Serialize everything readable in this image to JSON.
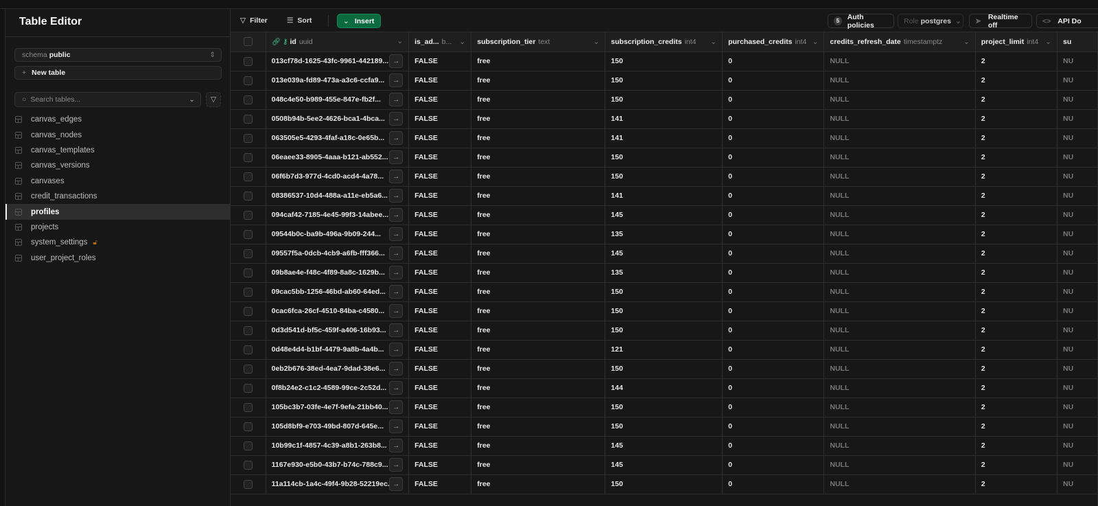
{
  "sidebar": {
    "title": "Table Editor",
    "schema_label": "schema",
    "schema_value": "public",
    "new_table": "New table",
    "search_placeholder": "Search tables...",
    "tables": [
      {
        "name": "canvas_edges"
      },
      {
        "name": "canvas_nodes"
      },
      {
        "name": "canvas_templates"
      },
      {
        "name": "canvas_versions"
      },
      {
        "name": "canvases"
      },
      {
        "name": "credit_transactions"
      },
      {
        "name": "profiles",
        "active": true
      },
      {
        "name": "projects"
      },
      {
        "name": "system_settings",
        "icon": "unlocked-icon"
      },
      {
        "name": "user_project_roles"
      }
    ]
  },
  "toolbar": {
    "filter": "Filter",
    "sort": "Sort",
    "insert": "Insert",
    "auth_count": "5",
    "auth": "Auth policies",
    "role_label": "Role",
    "role_value": "postgres",
    "realtime": "Realtime off",
    "api_docs": "API Do"
  },
  "colors": {
    "accent": "#0b6b3e",
    "background": "#171717",
    "lock": "#b26b16"
  },
  "columns": [
    {
      "name": "id",
      "type": "uuid"
    },
    {
      "name": "is_ad...",
      "type": "b..."
    },
    {
      "name": "subscription_tier",
      "type": "text"
    },
    {
      "name": "subscription_credits",
      "type": "int4"
    },
    {
      "name": "purchased_credits",
      "type": "int4"
    },
    {
      "name": "credits_refresh_date",
      "type": "timestamptz"
    },
    {
      "name": "project_limit",
      "type": "int4"
    },
    {
      "name": "su",
      "type": ""
    }
  ],
  "rows": [
    [
      "013cf78d-1625-43fc-9961-442189...",
      "150"
    ],
    [
      "013e039a-fd89-473a-a3c6-ccfa9...",
      "150"
    ],
    [
      "048c4e50-b989-455e-847e-fb2f...",
      "150"
    ],
    [
      "0508b94b-5ee2-4626-bca1-4bca...",
      "141"
    ],
    [
      "063505e5-4293-4faf-a18c-0e65b...",
      "141"
    ],
    [
      "06eaee33-8905-4aaa-b121-ab552...",
      "150"
    ],
    [
      "06f6b7d3-977d-4cd0-acd4-4a78...",
      "150"
    ],
    [
      "08386537-10d4-488a-a11e-eb5a6...",
      "141"
    ],
    [
      "094caf42-7185-4e45-99f3-14abee...",
      "145"
    ],
    [
      "09544b0c-ba9b-496a-9b09-244...",
      "135"
    ],
    [
      "09557f5a-0dcb-4cb9-a6fb-fff366...",
      "145"
    ],
    [
      "09b8ae4e-f48c-4f89-8a8c-1629b...",
      "135"
    ],
    [
      "09cac5bb-1256-46bd-ab60-64ed...",
      "150"
    ],
    [
      "0cac6fca-26cf-4510-84ba-c4580...",
      "150"
    ],
    [
      "0d3d541d-bf5c-459f-a406-16b93...",
      "150"
    ],
    [
      "0d48e4d4-b1bf-4479-9a8b-4a4b...",
      "121"
    ],
    [
      "0eb2b676-38ed-4ea7-9dad-38e6...",
      "150"
    ],
    [
      "0f8b24e2-c1c2-4589-99ce-2c52d...",
      "144"
    ],
    [
      "105bc3b7-03fe-4e7f-9efa-21bb40...",
      "150"
    ],
    [
      "105d8bf9-e703-49bd-807d-645e...",
      "150"
    ],
    [
      "10b99c1f-4857-4c39-a8b1-263b8...",
      "145"
    ],
    [
      "1167e930-e5b0-43b7-b74c-788c9...",
      "145"
    ],
    [
      "11a114cb-1a4c-49f4-9b28-52219ec...",
      "150"
    ]
  ],
  "row_defaults": {
    "is_admin": "FALSE",
    "tier": "free",
    "purchased": "0",
    "refresh": "NULL",
    "limit": "2",
    "su": "NU"
  }
}
